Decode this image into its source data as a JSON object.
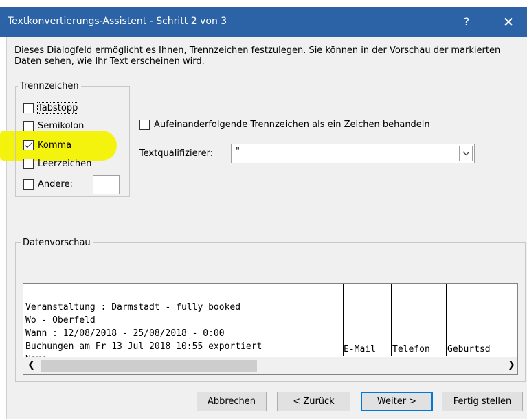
{
  "window": {
    "title": "Textkonvertierungs-Assistent - Schritt 2 von 3",
    "help_label": "?",
    "close_label": "✕",
    "titlebar_color": "#2b63a6"
  },
  "description": "Dieses Dialogfeld ermöglicht es Ihnen, Trennzeichen festzulegen. Sie können in der Vorschau der markierten Daten sehen, wie Ihr Text erscheinen wird.",
  "delimiters": {
    "group_label": "Trennzeichen",
    "tab": {
      "label": "Tabstopp",
      "checked": false
    },
    "semicolon": {
      "label": "Semikolon",
      "checked": false
    },
    "comma": {
      "label": "Komma",
      "checked": true
    },
    "space": {
      "label": "Leerzeichen",
      "checked": false
    },
    "other": {
      "label": "Andere:",
      "checked": false,
      "value": ""
    },
    "highlight_color": "#f2f200"
  },
  "options": {
    "consecutive_label": "Aufeinanderfolgende Trennzeichen als ein Zeichen behandeln",
    "consecutive_checked": false,
    "text_qualifier_label": "Textqualifizierer:",
    "text_qualifier_value": "\""
  },
  "preview": {
    "group_label": "Datenvorschau",
    "lines": [
      "Veranstaltung : Darmstadt - fully booked",
      "Wo - Oberfeld",
      "Wann : 12/08/2018 - 25/08/2018 - 0:00",
      "Buchungen am Fr 13 Jul 2018 10:55 exportiert",
      "Name"
    ],
    "columns": [
      "E-Mail",
      "Telefon",
      "Geburtsd"
    ]
  },
  "buttons": {
    "cancel": "Abbrechen",
    "back": "< Zurück",
    "next": "Weiter >",
    "finish": "Fertig stellen"
  }
}
